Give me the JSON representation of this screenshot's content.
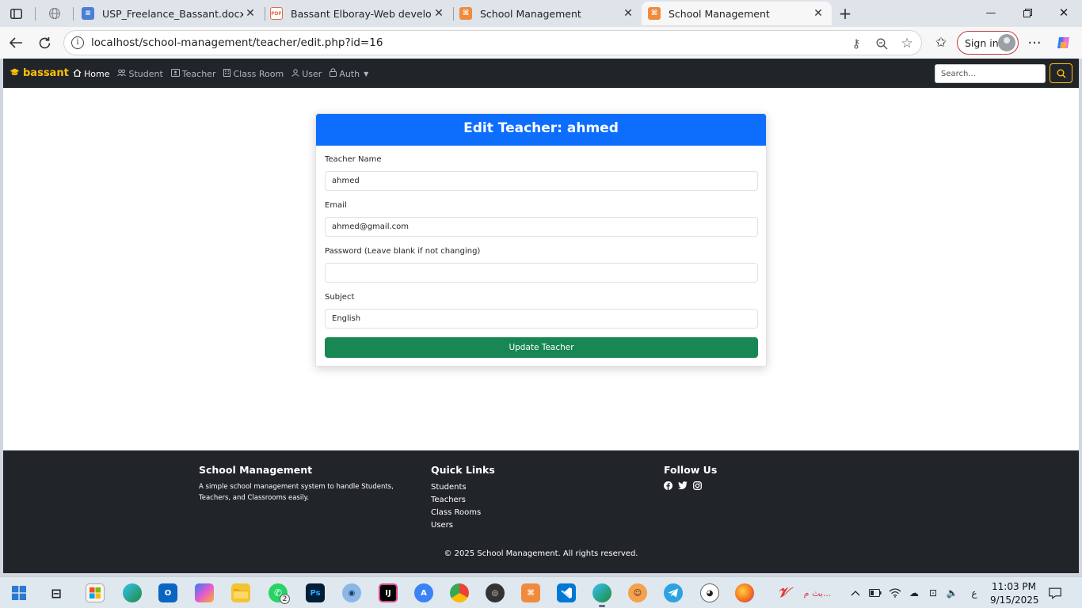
{
  "browser": {
    "tabs": [
      {
        "title": "USP_Freelance_Bassant.docx - ال",
        "favicon_color": "#4a7fd4"
      },
      {
        "title": "Bassant Elboray-Web developer.p",
        "favicon_color": "#e06b4a"
      },
      {
        "title": "School Management",
        "favicon_color": "#f08a3c"
      },
      {
        "title": "School Management",
        "favicon_color": "#f08a3c",
        "active": true
      }
    ],
    "address": "localhost/school-management/teacher/edit.php?id=16",
    "signin_label": "Sign in"
  },
  "navbar": {
    "brand": "bassant",
    "links": [
      {
        "label": "Home",
        "icon": "home-icon",
        "active": true
      },
      {
        "label": "Student",
        "icon": "people-icon"
      },
      {
        "label": "Teacher",
        "icon": "person-badge-icon"
      },
      {
        "label": "Class Room",
        "icon": "building-icon"
      },
      {
        "label": "User",
        "icon": "person-icon"
      },
      {
        "label": "Auth",
        "icon": "lock-icon",
        "dropdown": true
      }
    ],
    "search_placeholder": "Search..."
  },
  "form": {
    "title": "Edit Teacher: ahmed",
    "fields": [
      {
        "label": "Teacher Name",
        "value": "ahmed"
      },
      {
        "label": "Email",
        "value": "ahmed@gmail.com"
      },
      {
        "label": "Password (Leave blank if not changing)",
        "value": ""
      },
      {
        "label": "Subject",
        "value": "English"
      }
    ],
    "submit_label": "Update Teacher"
  },
  "footer": {
    "about_title": "School Management",
    "about_text": "A simple school management system to handle Students, Teachers, and Classrooms easily.",
    "links_title": "Quick Links",
    "links": [
      "Students",
      "Teachers",
      "Class Rooms",
      "Users"
    ],
    "follow_title": "Follow Us",
    "social": [
      "facebook-icon",
      "twitter-icon",
      "instagram-icon"
    ],
    "copyright": "© 2025 School Management. All rights reserved."
  },
  "taskbar": {
    "whatsapp_badge": "2",
    "time": "11:03 PM",
    "date": "9/15/2025",
    "lang": "ع"
  },
  "colors": {
    "primary": "#0d6efd",
    "success": "#198754",
    "dark": "#212529",
    "warning": "#ffc107"
  }
}
